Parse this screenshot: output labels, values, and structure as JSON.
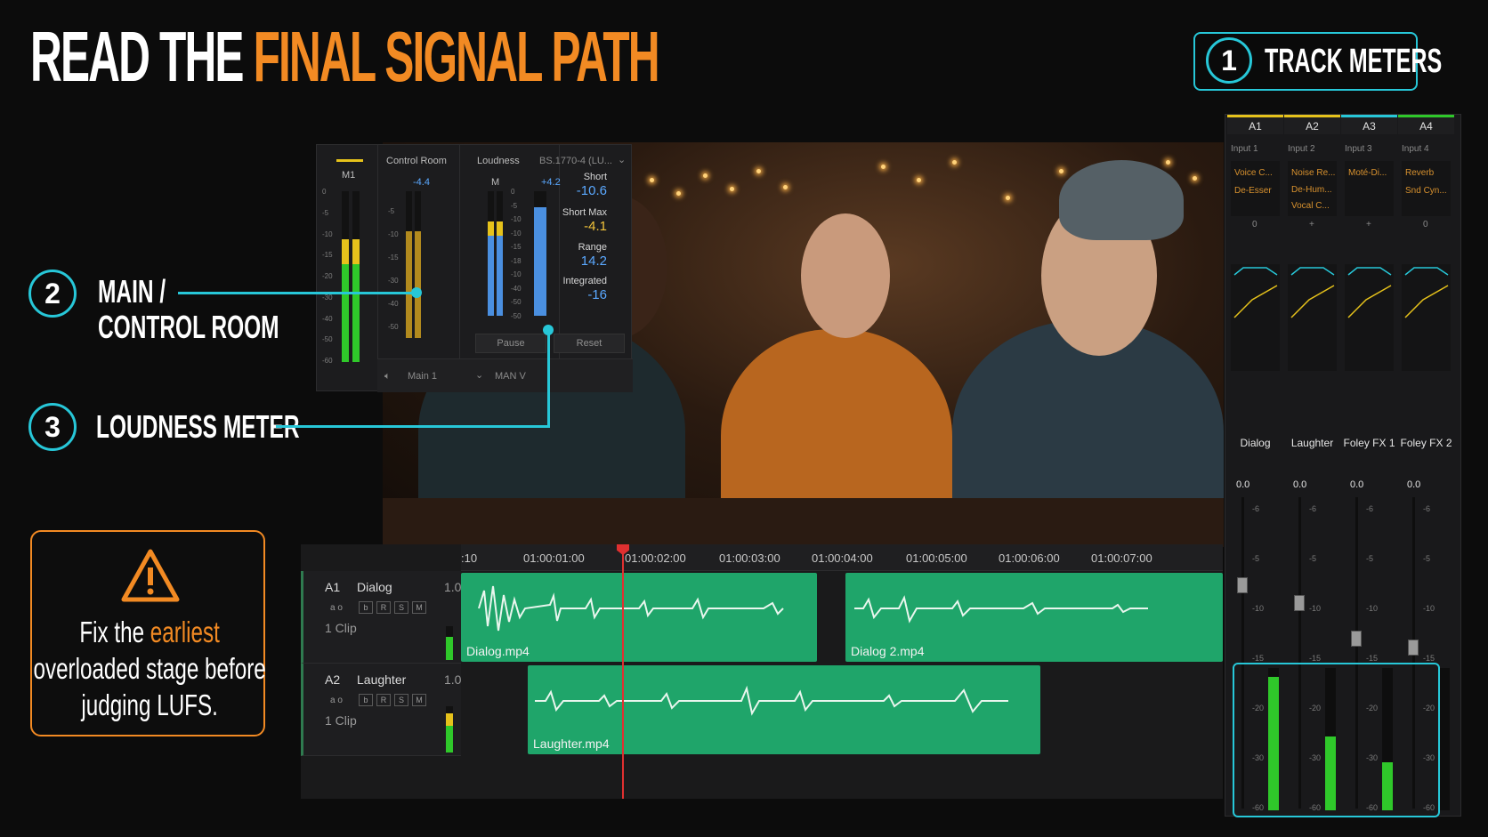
{
  "title": {
    "part1": "READ THE ",
    "part2": "FINAL SIGNAL PATH"
  },
  "callouts": {
    "c1": {
      "number": "1",
      "label": "TRACK METERS"
    },
    "c2": {
      "number": "2",
      "line1": "MAIN /",
      "line2": "CONTROL ROOM"
    },
    "c3": {
      "number": "3",
      "label": "LOUDNESS METER"
    }
  },
  "warning": {
    "before": "Fix the ",
    "highlight": "earliest",
    "after": "overloaded stage before judging LUFS."
  },
  "mixer": {
    "main_label": "M1",
    "control_room_label": "Control Room",
    "control_room_value": "-4.4",
    "loudness_label": "Loudness",
    "standard": "BS.1770-4 (LU...",
    "loudness_m": "M",
    "loudness_value": "+4.2",
    "stats": [
      {
        "label": "Short",
        "value": "-10.6",
        "color": "#5aa8ff"
      },
      {
        "label": "Short Max",
        "value": "-4.1",
        "color": "#f2c33a"
      },
      {
        "label": "Range",
        "value": "14.2",
        "color": "#5aa8ff"
      },
      {
        "label": "Integrated",
        "value": "-16",
        "color": "#5aa8ff"
      }
    ],
    "pause": "Pause",
    "reset": "Reset",
    "output": "Main 1",
    "mode": "MAN V",
    "scale_main": [
      "0",
      "-5",
      "-10",
      "-15",
      "-20",
      "-30",
      "-40",
      "-50",
      "-60"
    ],
    "scale_cr": [
      "-5",
      "-10",
      "-15",
      "-30",
      "-40",
      "-50"
    ],
    "scale_loud": [
      "0",
      "-5",
      "-10",
      "-10",
      "-15",
      "-18",
      "-10",
      "-40",
      "-50",
      "-50"
    ]
  },
  "timeline": {
    "timecodes": [
      ":10",
      "01:00:01:00",
      "01:00:02:00",
      "01:00:03:00",
      "01:00:04:00",
      "01:00:05:00",
      "01:00:06:00",
      "01:00:07:00"
    ],
    "tracks": [
      {
        "id": "A1",
        "name": "Dialog",
        "level": "1.0",
        "clips_label": "1 Clip",
        "small": "a o"
      },
      {
        "id": "A2",
        "name": "Laughter",
        "level": "1.0",
        "clips_label": "1 Clip",
        "small": "a o"
      }
    ],
    "clips": [
      "Dialog.mp4",
      "Dialog 2.mp4",
      "Laughter.mp4"
    ]
  },
  "track_meters": {
    "channels": [
      {
        "id": "A1",
        "input": "Input 1",
        "fx": [
          "Voice C...",
          "De-Esser"
        ],
        "pan": "0",
        "name": "Dialog",
        "level": "0.0",
        "color": "#e6c21b",
        "meter": 0.94
      },
      {
        "id": "A2",
        "input": "Input 2",
        "fx": [
          "Noise Re...",
          "De-Hum...",
          "Vocal C..."
        ],
        "pan": "+",
        "name": "Laughter",
        "level": "0.0",
        "color": "#e6c21b",
        "meter": 0.52
      },
      {
        "id": "A3",
        "input": "Input 3",
        "fx": [
          "Moté-Di..."
        ],
        "pan": "+",
        "name": "Foley FX 1",
        "level": "0.0",
        "color": "#27c7d8",
        "meter": 0.34
      },
      {
        "id": "A4",
        "input": "Input 4",
        "fx": [
          "Reverb",
          "Snd Cyn..."
        ],
        "pan": "0",
        "name": "Foley FX 2",
        "level": "0.0",
        "color": "#2fc82a",
        "meter": 0.0
      }
    ]
  },
  "colors": {
    "accent": "#f28a23",
    "callout": "#27c7d8",
    "clip": "#1fa56a",
    "meter_green": "#2fc82a",
    "meter_yellow": "#e6c21b",
    "playhead": "#e13030"
  }
}
